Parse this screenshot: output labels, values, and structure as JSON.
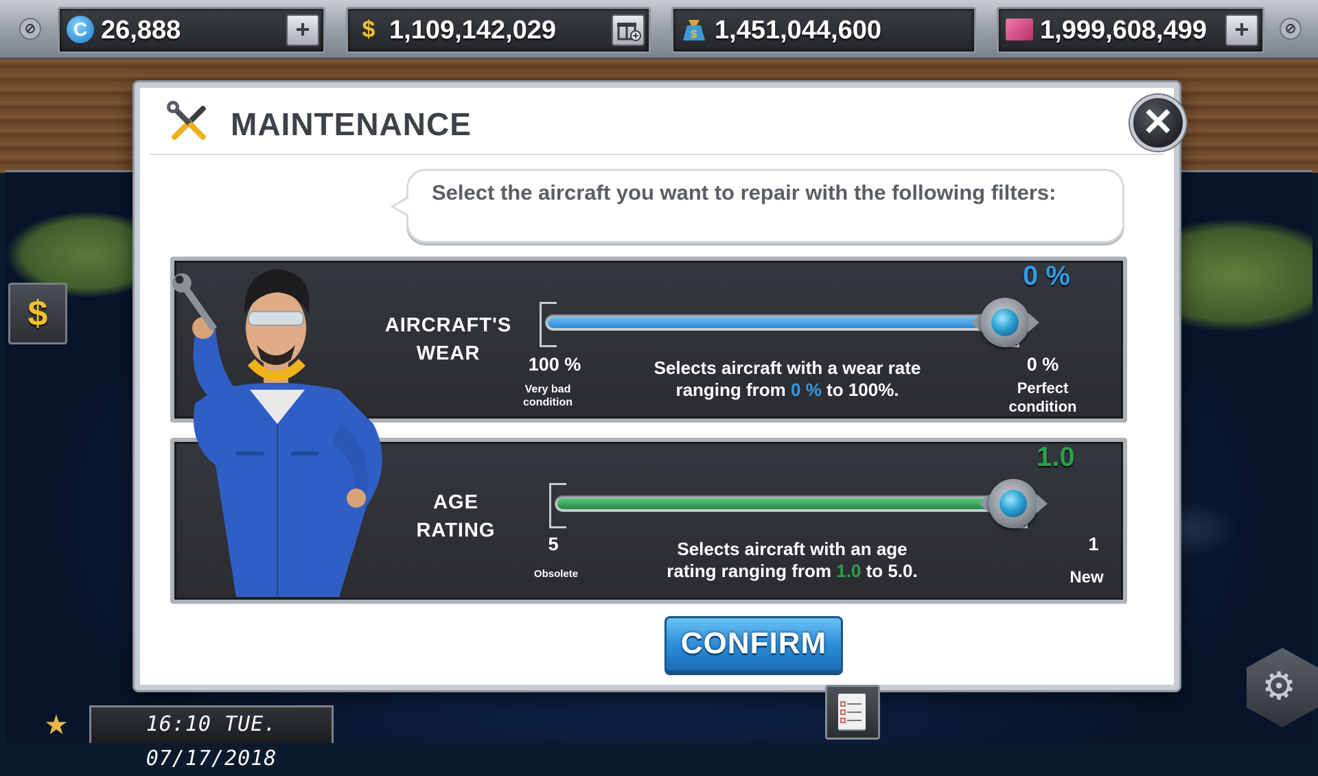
{
  "currencies": [
    {
      "icon": "coin-c-icon",
      "symbol": "C",
      "value": "26,888",
      "action": "+"
    },
    {
      "icon": "dollar-icon",
      "symbol": "$",
      "value": "1,109,142,029",
      "action": "gift"
    },
    {
      "icon": "fuel-bag-icon",
      "symbol": "$",
      "value": "1,451,044,600",
      "action": ""
    },
    {
      "icon": "ticket-icon",
      "symbol": "",
      "value": "1,999,608,499",
      "action": "+"
    }
  ],
  "side": {
    "dollar_label": "$"
  },
  "modal": {
    "title": "MAINTENANCE",
    "close": "✕",
    "instruction": "Select the aircraft you want to repair with the following filters:",
    "wear": {
      "label_line1": "AIRCRAFT'S",
      "label_line2": "WEAR",
      "current": "0 %",
      "current_value_pct": 0,
      "left_value": "100 %",
      "left_caption_line1": "Very bad",
      "left_caption_line2": "condition",
      "right_value": "0 %",
      "right_caption_line1": "Perfect",
      "right_caption_line2": "condition",
      "desc_line1": "Selects aircraft with a wear rate",
      "desc_pre": "ranging from ",
      "desc_highlight": "0 %",
      "desc_post": " to 100%.",
      "color": "#2f9ae6"
    },
    "age": {
      "label_line1": "AGE",
      "label_line2": "RATING",
      "current": "1.0",
      "current_value": 1.0,
      "left_value": "5",
      "left_caption": "Obsolete",
      "right_value": "1",
      "right_caption": "New",
      "desc_line1": "Selects aircraft with an age",
      "desc_pre": "rating ranging from ",
      "desc_highlight": "1.0",
      "desc_post": " to 5.0.",
      "color": "#2aa14b"
    },
    "confirm": "CONFIRM"
  },
  "status": {
    "datetime": "16:10 TUE. 07/17/2018"
  },
  "colors": {
    "accent_blue": "#2f9ae6",
    "accent_green": "#2aa14b",
    "gold": "#f3c02b"
  }
}
